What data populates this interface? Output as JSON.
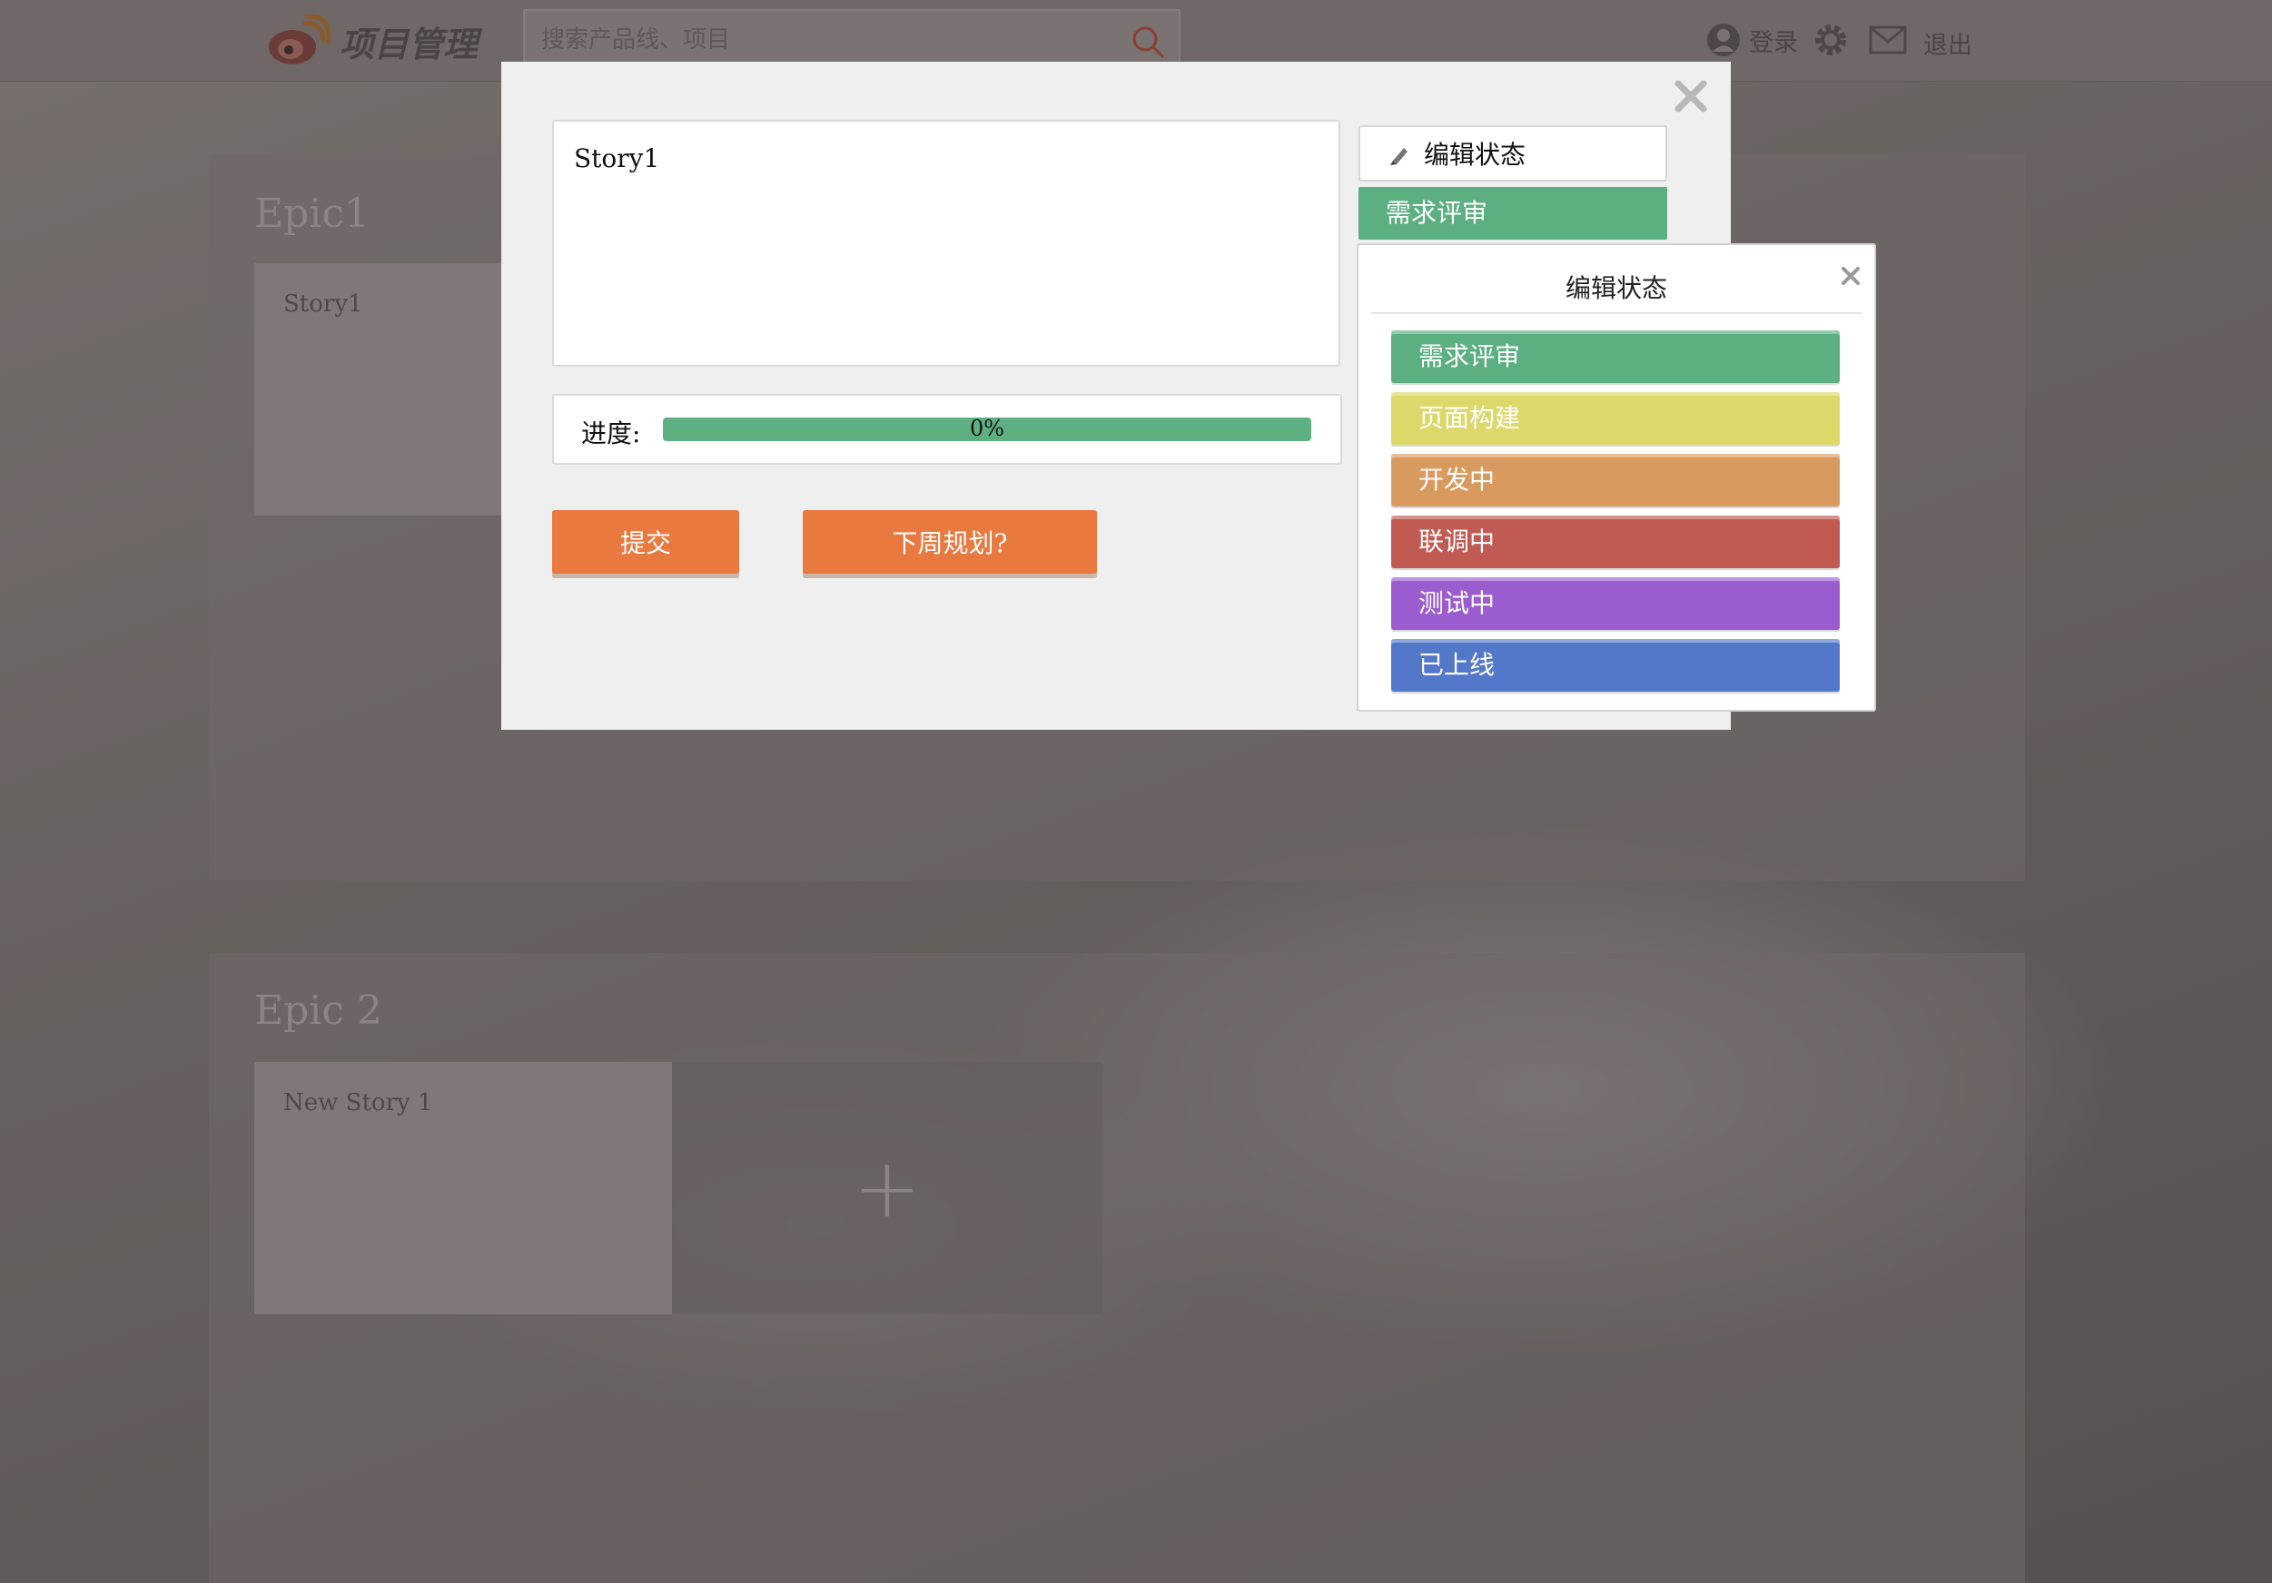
{
  "header": {
    "logo_text": "项目管理",
    "search_placeholder": "搜索产品线、项目",
    "login": "登录",
    "logout": "退出"
  },
  "epics": [
    {
      "title": "Epic1",
      "stories": [
        "Story1"
      ]
    },
    {
      "title": "Epic 2",
      "stories": [
        "New Story 1"
      ],
      "add_symbol": "+"
    }
  ],
  "modal": {
    "story_text": "Story1",
    "progress_label": "进度:",
    "progress_value": 0,
    "progress_text": "0%",
    "submit_label": "提交",
    "plan_label": "下周规划?",
    "edit_status_label": "编辑状态",
    "current_status": "需求评审"
  },
  "status_popover": {
    "title": "编辑状态",
    "options": [
      {
        "label": "需求评审",
        "color": "#5caf81"
      },
      {
        "label": "页面构建",
        "color": "#dcd86a"
      },
      {
        "label": "开发中",
        "color": "#d99a5f"
      },
      {
        "label": "联调中",
        "color": "#c05a52"
      },
      {
        "label": "测试中",
        "color": "#9a5ccf"
      },
      {
        "label": "已上线",
        "color": "#5478c9"
      }
    ]
  }
}
